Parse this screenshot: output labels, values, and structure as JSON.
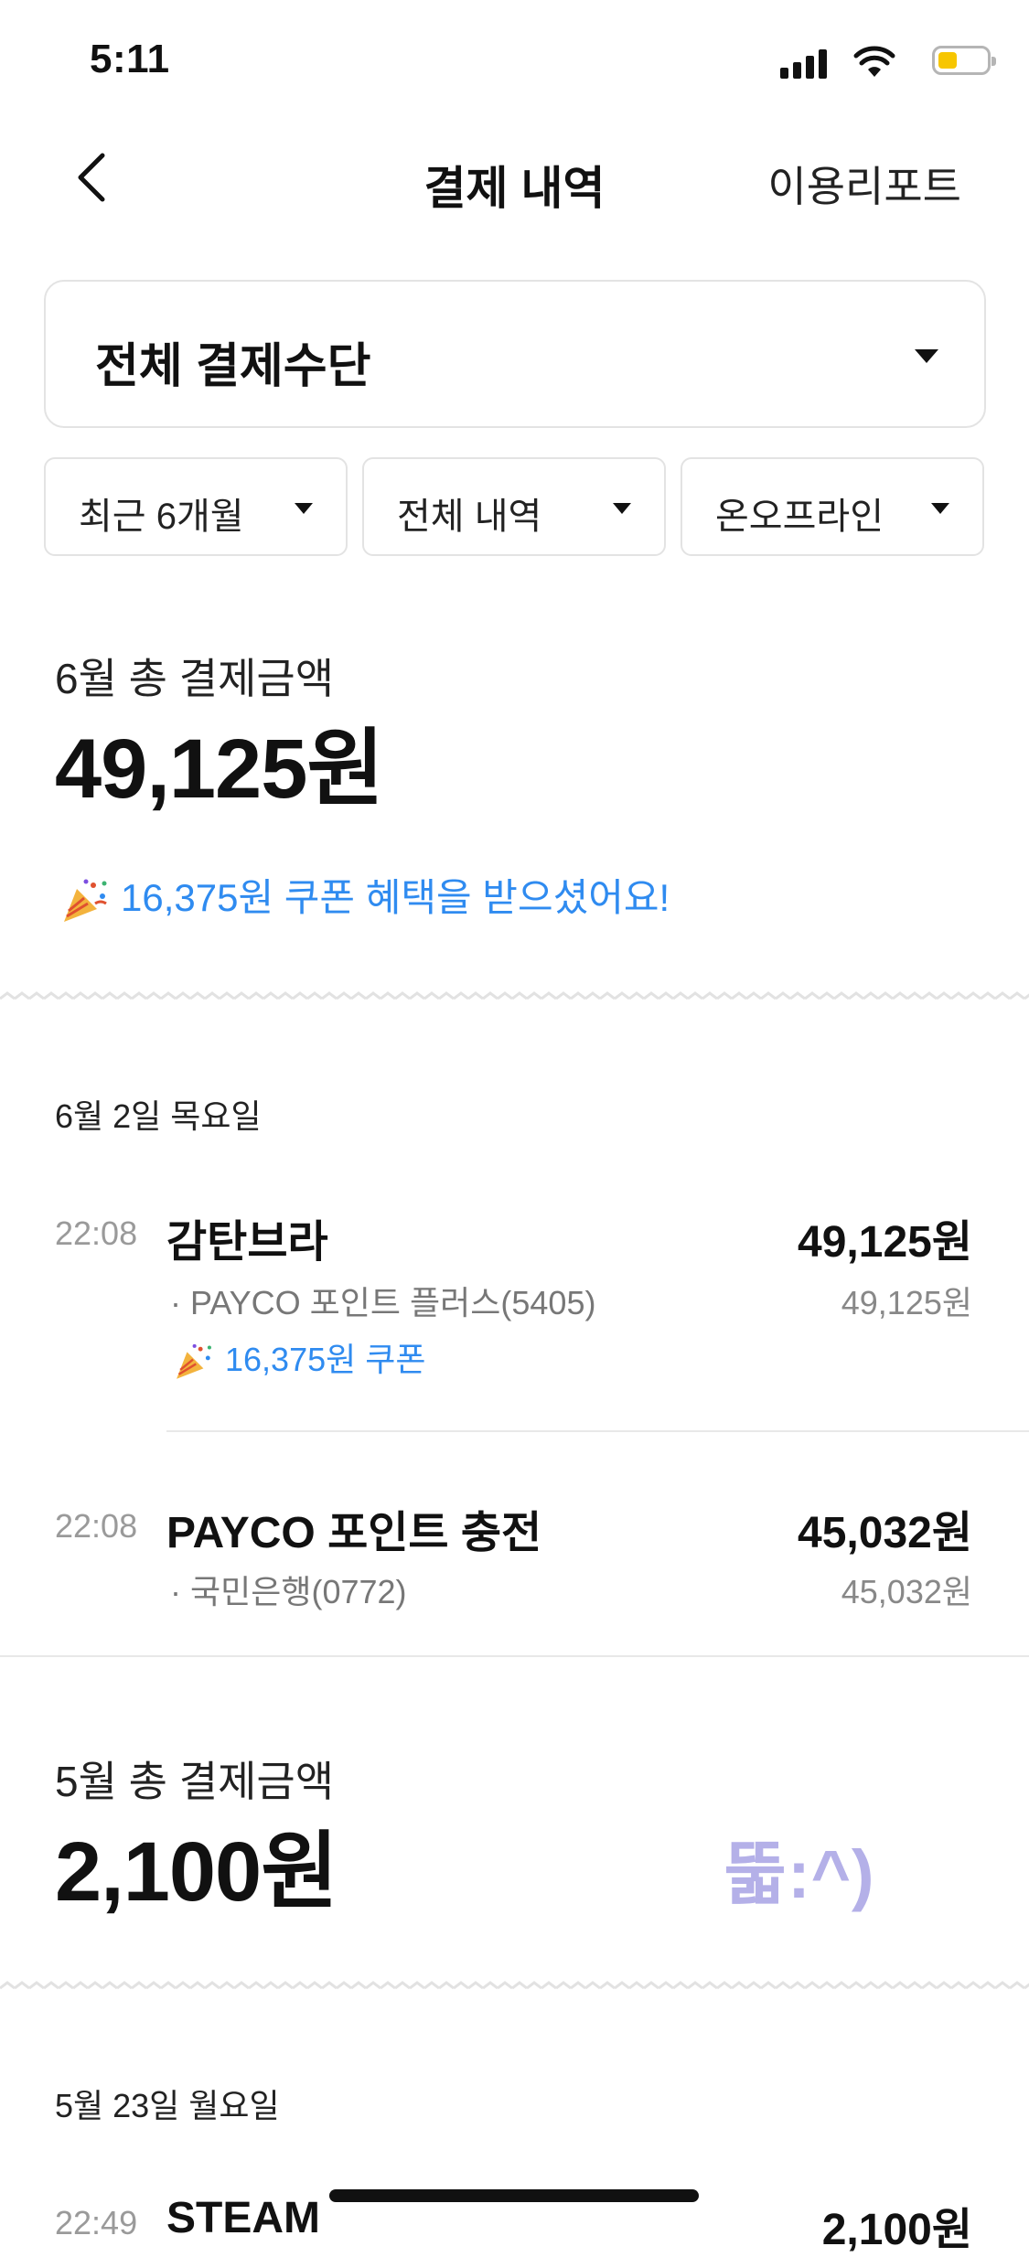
{
  "status_bar": {
    "time": "5:11",
    "battery_color": "#f7c600"
  },
  "header": {
    "title": "결제 내역",
    "report_link": "이용리포트",
    "back_icon": "chevron-left-icon"
  },
  "payment_method": {
    "selected": "전체 결제수단"
  },
  "filters": [
    {
      "label": "최근 6개월"
    },
    {
      "label": "전체 내역"
    },
    {
      "label": "온오프라인"
    }
  ],
  "months": [
    {
      "label": "6월 총 결제금액",
      "total": "49,125원",
      "coupon_banner": "16,375원 쿠폰 혜택을 받으셨어요!",
      "days": [
        {
          "date": "6월 2일 목요일",
          "transactions": [
            {
              "time": "22:08",
              "merchant": "감탄브라",
              "amount": "49,125원",
              "method": "· PAYCO 포인트 플러스(5405)",
              "sub_amount": "49,125원",
              "coupon": "16,375원 쿠폰"
            },
            {
              "time": "22:08",
              "merchant": "PAYCO 포인트 충전",
              "amount": "45,032원",
              "method": "· 국민은행(0772)",
              "sub_amount": "45,032원"
            }
          ]
        }
      ]
    },
    {
      "label": "5월 총 결제금액",
      "total": "2,100원",
      "days": [
        {
          "date": "5월 23일 월요일",
          "transactions": [
            {
              "time": "22:49",
              "merchant": "STEAM",
              "amount": "2,100원"
            }
          ]
        }
      ]
    }
  ],
  "watermark": "뚧:^)",
  "colors": {
    "accent_blue": "#2f8bf0",
    "text": "#111111",
    "muted": "#9a9a9a",
    "watermark": "#b4b0e8"
  }
}
